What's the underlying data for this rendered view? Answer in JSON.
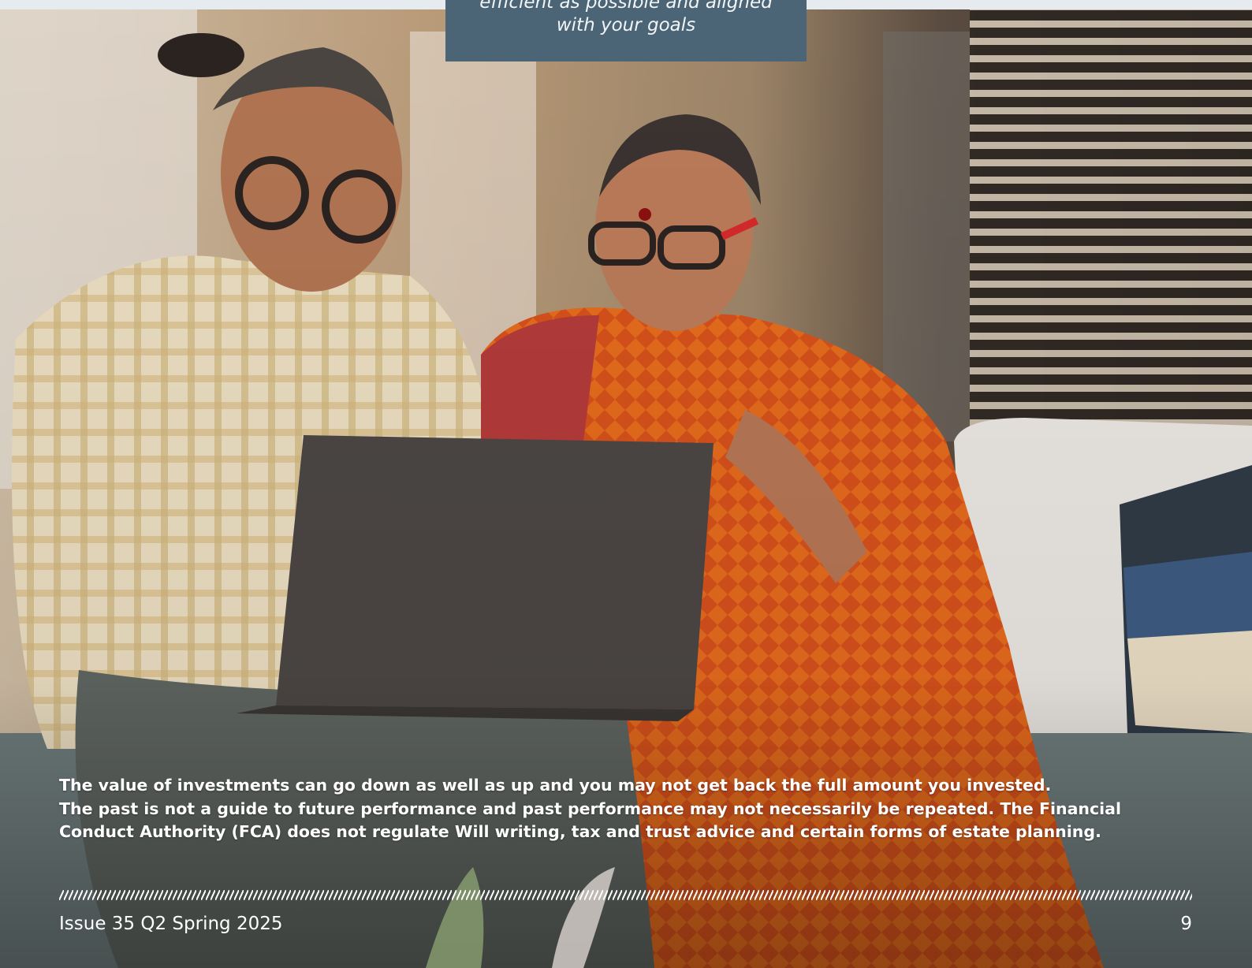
{
  "quote": {
    "line1": "efficient as possible and aligned",
    "line2": "with your goals"
  },
  "disclaimer": {
    "line1": "The value of investments can go down as well as up and you may not get back the full amount you invested.",
    "line2": "The past is not a guide to future performance and past performance may not necessarily be repeated. The Financial",
    "line3": "Conduct Authority (FCA) does not regulate Will writing, tax and trust advice and certain forms of estate planning."
  },
  "footer": {
    "issue": "Issue 35 Q2 Spring 2025",
    "page_number": "9"
  },
  "colors": {
    "quote_box": "#4b6576",
    "text": "#ffffff"
  }
}
